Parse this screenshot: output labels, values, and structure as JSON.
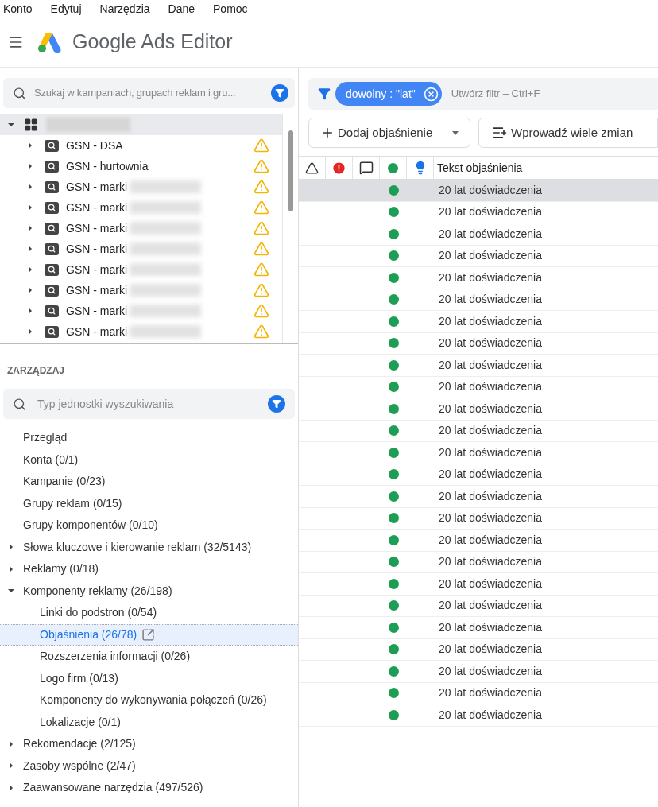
{
  "menu": [
    "Konto",
    "Edytuj",
    "Narzędzia",
    "Dane",
    "Pomoc"
  ],
  "app_title": "Google Ads Editor",
  "tree_search": {
    "placeholder": "Szukaj w kampaniach, grupach reklam i gru..."
  },
  "account": {
    "expanded": true
  },
  "campaigns": [
    {
      "name": "GSN - DSA",
      "expanded": false,
      "blurred": false,
      "warning": true
    },
    {
      "name": "GSN - hurtownia",
      "expanded": false,
      "blurred": false,
      "warning": true
    },
    {
      "name": "GSN - marki",
      "expanded": false,
      "blurred": true,
      "warning": true
    },
    {
      "name": "GSN - marki",
      "expanded": false,
      "blurred": true,
      "warning": true
    },
    {
      "name": "GSN - marki",
      "expanded": false,
      "blurred": true,
      "warning": true
    },
    {
      "name": "GSN - marki",
      "expanded": false,
      "blurred": true,
      "warning": true
    },
    {
      "name": "GSN - marki",
      "expanded": false,
      "blurred": true,
      "warning": true
    },
    {
      "name": "GSN - marki",
      "expanded": false,
      "blurred": true,
      "warning": true
    },
    {
      "name": "GSN - marki",
      "expanded": false,
      "blurred": true,
      "warning": true
    },
    {
      "name": "GSN - marki",
      "expanded": false,
      "blurred": true,
      "warning": true
    }
  ],
  "manage": {
    "title": "ZARZĄDZAJ",
    "search": {
      "placeholder": "Typ jednostki wyszukiwania"
    },
    "items": [
      {
        "label": "Przegląd",
        "selected": false
      },
      {
        "label": "Konta (0/1)",
        "selected": false
      },
      {
        "label": "Kampanie (0/23)",
        "selected": false
      },
      {
        "label": "Grupy reklam (0/15)",
        "selected": false
      },
      {
        "label": "Grupy komponentów (0/10)",
        "selected": false
      },
      {
        "label": "Słowa kluczowe i kierowanie reklam (32/5143)",
        "selected": false,
        "expanded": false
      },
      {
        "label": "Reklamy (0/18)",
        "selected": false,
        "expanded": false
      },
      {
        "label": "Komponenty reklamy (26/198)",
        "selected": false,
        "expanded": true,
        "children": [
          {
            "label": "Linki do podstron (0/54)",
            "selected": false
          },
          {
            "label": "Objaśnienia (26/78)",
            "selected": true
          },
          {
            "label": "Rozszerzenia informacji (0/26)",
            "selected": false
          },
          {
            "label": "Logo firm (0/13)",
            "selected": false
          },
          {
            "label": "Komponenty do wykonywania połączeń (0/26)",
            "selected": false
          },
          {
            "label": "Lokalizacje (0/1)",
            "selected": false
          }
        ]
      },
      {
        "label": "Rekomendacje (2/125)",
        "selected": false,
        "expanded": false
      },
      {
        "label": "Zasoby wspólne (2/47)",
        "selected": false,
        "expanded": false
      },
      {
        "label": "Zaawansowane narzędzia (497/526)",
        "selected": false,
        "expanded": false
      }
    ]
  },
  "filter": {
    "chip": "dowolny : \"lat\"",
    "placeholder": "Utwórz filtr – Ctrl+F"
  },
  "buttons": [
    "Dodaj objaśnienie",
    "Wprowadź wiele zmian"
  ],
  "table": {
    "column": "Tekst objaśnienia",
    "rows": [
      {
        "text": "20 lat doświadczenia",
        "selected": true
      },
      {
        "text": "20 lat doświadczenia",
        "selected": false
      },
      {
        "text": "20 lat doświadczenia",
        "selected": false
      },
      {
        "text": "20 lat doświadczenia",
        "selected": false
      },
      {
        "text": "20 lat doświadczenia",
        "selected": false
      },
      {
        "text": "20 lat doświadczenia",
        "selected": false
      },
      {
        "text": "20 lat doświadczenia",
        "selected": false
      },
      {
        "text": "20 lat doświadczenia",
        "selected": false
      },
      {
        "text": "20 lat doświadczenia",
        "selected": false
      },
      {
        "text": "20 lat doświadczenia",
        "selected": false
      },
      {
        "text": "20 lat doświadczenia",
        "selected": false
      },
      {
        "text": "20 lat doświadczenia",
        "selected": false
      },
      {
        "text": "20 lat doświadczenia",
        "selected": false
      },
      {
        "text": "20 lat doświadczenia",
        "selected": false
      },
      {
        "text": "20 lat doświadczenia",
        "selected": false
      },
      {
        "text": "20 lat doświadczenia",
        "selected": false
      },
      {
        "text": "20 lat doświadczenia",
        "selected": false
      },
      {
        "text": "20 lat doświadczenia",
        "selected": false
      },
      {
        "text": "20 lat doświadczenia",
        "selected": false
      },
      {
        "text": "20 lat doświadczenia",
        "selected": false
      },
      {
        "text": "20 lat doświadczenia",
        "selected": false
      },
      {
        "text": "20 lat doświadczenia",
        "selected": false
      },
      {
        "text": "20 lat doświadczenia",
        "selected": false
      },
      {
        "text": "20 lat doświadczenia",
        "selected": false
      },
      {
        "text": "20 lat doświadczenia",
        "selected": false
      }
    ]
  }
}
